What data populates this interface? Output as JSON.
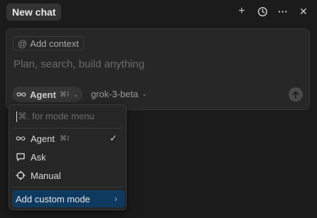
{
  "header": {
    "tab_title": "New chat",
    "icons": [
      "plus-icon",
      "history-icon",
      "more-icon",
      "close-icon"
    ],
    "plus_glyph": "+",
    "more_glyph": "···",
    "close_glyph": "✕"
  },
  "composer": {
    "context_chip": {
      "at": "@",
      "label": "Add context"
    },
    "placeholder": "Plan, search, build anything",
    "mode": {
      "label": "Agent",
      "shortcut": "⌘I"
    },
    "model": {
      "label": "grok-3-beta"
    }
  },
  "mode_menu": {
    "search_placeholder": "⌘. for mode menu",
    "items": [
      {
        "label": "Agent",
        "shortcut": "⌘I",
        "icon": "infinity-icon",
        "selected": true,
        "check": "✓"
      },
      {
        "label": "Ask",
        "icon": "chat-bubble-icon"
      },
      {
        "label": "Manual",
        "icon": "crosshair-icon"
      }
    ],
    "custom": {
      "label": "Add custom mode",
      "arrow": "›"
    }
  },
  "colors": {
    "background": "#1b1b1b",
    "panel": "#272727",
    "highlight": "#0e3a5f"
  }
}
